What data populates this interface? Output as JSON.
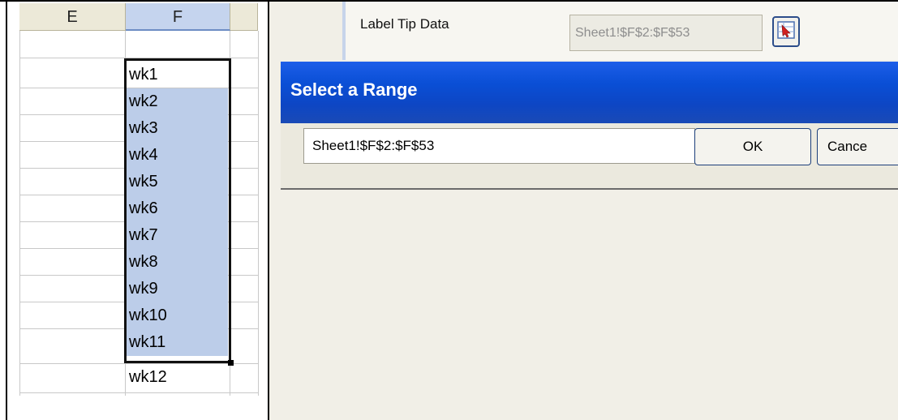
{
  "spreadsheet": {
    "columns": [
      {
        "label": "E"
      },
      {
        "label": "F"
      }
    ],
    "cells": [
      "wk1",
      "wk2",
      "wk3",
      "wk4",
      "wk5",
      "wk6",
      "wk7",
      "wk8",
      "wk9",
      "wk10",
      "wk11",
      "wk12"
    ]
  },
  "properties": {
    "label_tip_data_label": "Label Tip Data",
    "label_tip_data_value": "Sheet1!$F$2:$F$53"
  },
  "dialog": {
    "title": "Select a Range",
    "range_value": "Sheet1!$F$2:$F$53",
    "ok_label": "OK",
    "cancel_label": "Cance"
  },
  "colors": {
    "selection_fill": "#bccde9",
    "title_bar": "#0a4fd6"
  }
}
